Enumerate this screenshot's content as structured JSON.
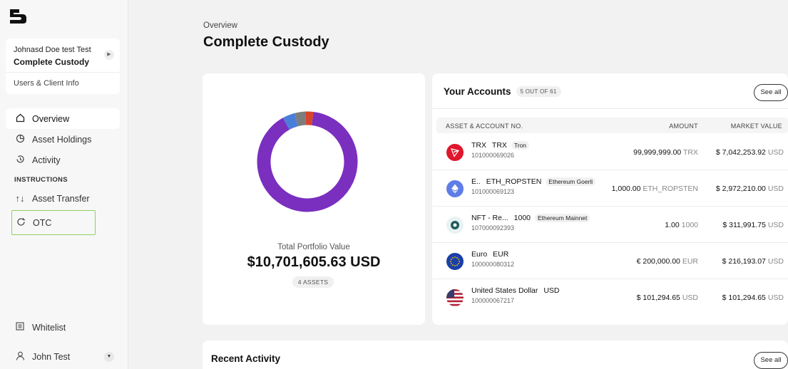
{
  "sidebar": {
    "org_user": "Johnasd Doe test Test",
    "org_name": "Complete Custody",
    "users_link": "Users & Client Info",
    "nav": [
      {
        "label": "Overview",
        "icon": "home-icon"
      },
      {
        "label": "Asset Holdings",
        "icon": "pie-chart-icon"
      },
      {
        "label": "Activity",
        "icon": "history-icon"
      }
    ],
    "section_label": "INSTRUCTIONS",
    "instructions": [
      {
        "label": "Asset Transfer",
        "icon": "transfer-arrows-icon"
      },
      {
        "label": "OTC",
        "icon": "refresh-icon"
      }
    ],
    "whitelist_label": "Whitelist",
    "user_name": "John Test"
  },
  "header": {
    "breadcrumb": "Overview",
    "title": "Complete Custody"
  },
  "portfolio": {
    "label": "Total Portfolio Value",
    "value": "$10,701,605.63 USD",
    "assets_badge": "4 ASSETS",
    "donut": [
      {
        "share": 0.9,
        "color": "#7a2fbf"
      },
      {
        "share": 0.04,
        "color": "#4a7fd9"
      },
      {
        "share": 0.035,
        "color": "#7d7d7d"
      },
      {
        "share": 0.025,
        "color": "#d8452a"
      }
    ]
  },
  "accounts": {
    "title": "Your Accounts",
    "count": "5 OUT OF 61",
    "see_all": "See all",
    "columns": {
      "asset": "ASSET & ACCOUNT NO.",
      "amount": "AMOUNT",
      "market_value": "MARKET VALUE"
    },
    "rows": [
      {
        "name": "TRX",
        "code": "TRX",
        "tag": "Tron",
        "account_no": "101000069026",
        "amount": "99,999,999.00",
        "amount_unit": "TRX",
        "market_value": "$ 7,042,253.92",
        "mv_unit": "USD",
        "icon": "tron-icon",
        "color": "#e0162b"
      },
      {
        "name": "E..",
        "code": "ETH_ROPSTEN",
        "tag": "Ethereum Goerli",
        "account_no": "101000069123",
        "amount": "1,000.00",
        "amount_unit": "ETH_ROPSTEN",
        "market_value": "$ 2,972,210.00",
        "mv_unit": "USD",
        "icon": "ethereum-icon",
        "color": "#5f7de8"
      },
      {
        "name": "NFT - Re...",
        "code": "1000",
        "tag": "Ethereum Mainnet",
        "account_no": "107000092393",
        "amount": "1.00",
        "amount_unit": "1000",
        "market_value": "$ 311,991.75",
        "mv_unit": "USD",
        "icon": "nft-icon",
        "color": "#1f5c5c"
      },
      {
        "name": "Euro",
        "code": "EUR",
        "tag": "",
        "account_no": "100000080312",
        "amount": "€ 200,000.00",
        "amount_unit": "EUR",
        "market_value": "$ 216,193.07",
        "mv_unit": "USD",
        "icon": "eu-flag-icon",
        "color": "#1a3fa8"
      },
      {
        "name": "United States Dollar",
        "code": "USD",
        "tag": "",
        "account_no": "100000067217",
        "amount": "$ 101,294.65",
        "amount_unit": "USD",
        "market_value": "$ 101,294.65",
        "mv_unit": "USD",
        "icon": "us-flag-icon",
        "color": "#b22234"
      }
    ]
  },
  "recent": {
    "title": "Recent Activity",
    "see_all": "See all"
  }
}
